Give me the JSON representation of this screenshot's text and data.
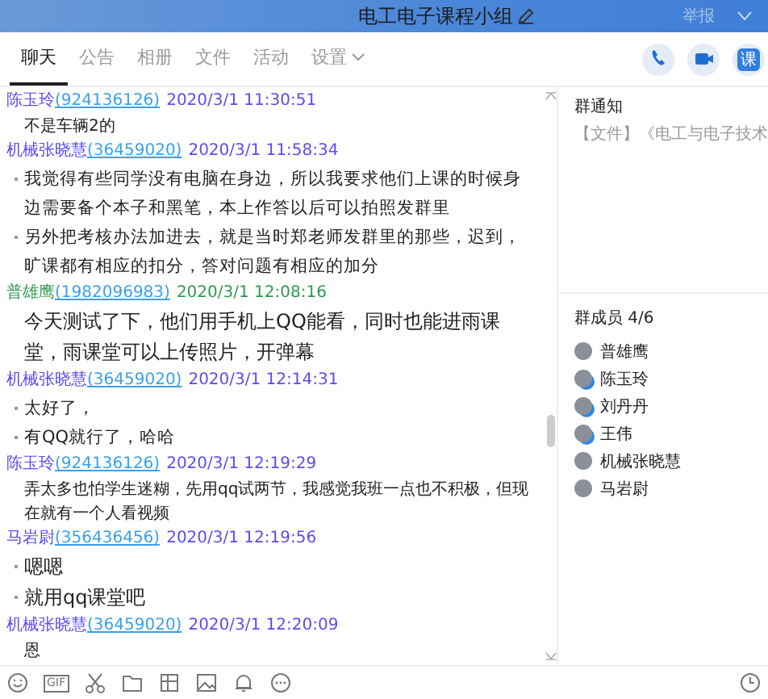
{
  "window": {
    "title": "电工电子课程小组",
    "report": "举报"
  },
  "tabs": [
    {
      "label": "聊天",
      "selected": true,
      "dropdown": false
    },
    {
      "label": "公告",
      "selected": false,
      "dropdown": false
    },
    {
      "label": "相册",
      "selected": false,
      "dropdown": false
    },
    {
      "label": "文件",
      "selected": false,
      "dropdown": false
    },
    {
      "label": "活动",
      "selected": false,
      "dropdown": false
    },
    {
      "label": "设置",
      "selected": false,
      "dropdown": true
    }
  ],
  "header_tools": [
    {
      "kind": "phone"
    },
    {
      "kind": "video"
    },
    {
      "kind": "class",
      "label": "课"
    }
  ],
  "messages": [
    {
      "sender": "陈玉玲",
      "id": "(924136126)",
      "time": "2020/3/1 11:30:51",
      "color": "#5b4cf0",
      "kind": "small",
      "bulleted": false,
      "paragraphs": [
        "不是车辆2的"
      ]
    },
    {
      "sender": "机械张晓慧",
      "id": "(36459020)",
      "time": "2020/3/1 11:58:34",
      "color": "#5b4cf0",
      "kind": "medium",
      "bulleted": true,
      "paragraphs": [
        "我觉得有些同学没有电脑在身边，所以我要求他们上课的时候身边需要备个本子和黑笔，本上作答以后可以拍照发群里",
        "另外把考核办法加进去，就是当时郑老师发群里的那些，迟到，旷课都有相应的扣分，答对问题有相应的加分"
      ]
    },
    {
      "sender": "普雄鹰",
      "id": "(1982096983)",
      "time": "2020/3/1 12:08:16",
      "color": "#2e9a4e",
      "kind": "large",
      "bulleted": false,
      "paragraphs": [
        "今天测试了下，他们用手机上QQ能看，同时也能进雨课堂，雨课堂可以上传照片，开弹幕"
      ]
    },
    {
      "sender": "机械张晓慧",
      "id": "(36459020)",
      "time": "2020/3/1 12:14:31",
      "color": "#5b4cf0",
      "kind": "medium",
      "bulleted": true,
      "paragraphs": [
        "太好了，",
        "有QQ就行了，哈哈"
      ]
    },
    {
      "sender": "陈玉玲",
      "id": "(924136126)",
      "time": "2020/3/1 12:19:29",
      "color": "#5b4cf0",
      "kind": "small",
      "bulleted": false,
      "paragraphs": [
        "弄太多也怕学生迷糊，先用qq试两节，我感觉我班一点也不积极，但现在就有一个人看视频"
      ]
    },
    {
      "sender": "马岩尉",
      "id": "(356436456)",
      "time": "2020/3/1 12:19:56",
      "color": "#5b4cf0",
      "kind": "large",
      "bulleted": true,
      "paragraphs": [
        "嗯嗯",
        "就用qq课堂吧"
      ]
    },
    {
      "sender": "机械张晓慧",
      "id": "(36459020)",
      "time": "2020/3/1 12:20:09",
      "color": "#5b4cf0",
      "kind": "small",
      "bulleted": false,
      "paragraphs": [
        "恩"
      ]
    }
  ],
  "notice": {
    "title": "群通知",
    "text": "【文件】《电工与电子技术"
  },
  "members": {
    "title": "群成员 4/6",
    "items": [
      {
        "name": "普雄鹰",
        "mobile": false
      },
      {
        "name": "陈玉玲",
        "mobile": true
      },
      {
        "name": "刘丹丹",
        "mobile": true
      },
      {
        "name": "王伟",
        "mobile": true
      },
      {
        "name": "机械张晓慧",
        "mobile": false
      },
      {
        "name": "马岩尉",
        "mobile": false
      }
    ]
  },
  "toolbar": [
    {
      "kind": "emoji"
    },
    {
      "kind": "gif",
      "label": "GIF"
    },
    {
      "kind": "scissors"
    },
    {
      "kind": "folder"
    },
    {
      "kind": "screenshot"
    },
    {
      "kind": "image"
    },
    {
      "kind": "bell"
    },
    {
      "kind": "more"
    },
    {
      "kind": "history"
    }
  ]
}
